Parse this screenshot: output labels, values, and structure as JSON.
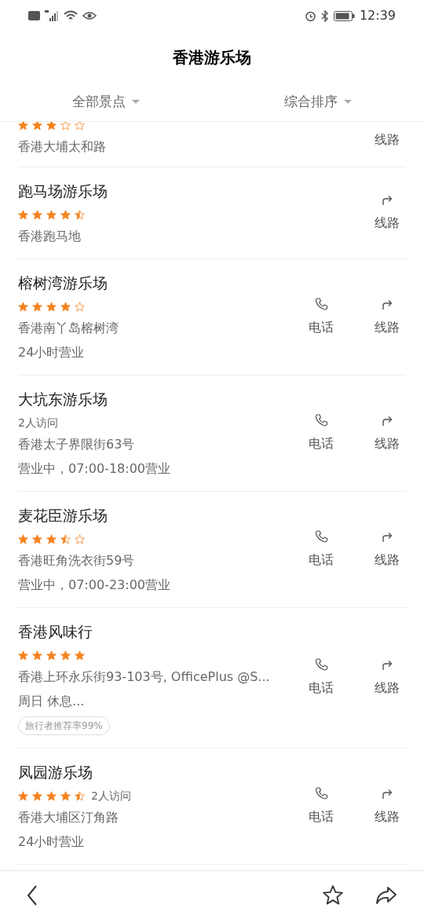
{
  "status_bar": {
    "time": "12:39"
  },
  "title": "香港游乐场",
  "filters": [
    {
      "label": "全部景点"
    },
    {
      "label": "综合排序"
    }
  ],
  "items": [
    {
      "stars": 3,
      "address": "香港大埔太和路",
      "actions": [
        {
          "kind": "route",
          "label": "线路"
        }
      ]
    },
    {
      "name": "跑马场游乐场",
      "stars": 4.5,
      "address": "香港跑马地",
      "actions": [
        {
          "kind": "route",
          "label": "线路"
        }
      ]
    },
    {
      "name": "榕树湾游乐场",
      "stars": 4,
      "address": "香港南丫岛榕树湾",
      "hours": "24小时营业",
      "actions": [
        {
          "kind": "phone",
          "label": "电话"
        },
        {
          "kind": "route",
          "label": "线路"
        }
      ]
    },
    {
      "name": "大坑东游乐场",
      "visits": "2人访问",
      "address": "香港太子界限街63号",
      "hours": "营业中，07:00-18:00营业",
      "actions": [
        {
          "kind": "phone",
          "label": "电话"
        },
        {
          "kind": "route",
          "label": "线路"
        }
      ]
    },
    {
      "name": "麦花臣游乐场",
      "stars": 3.5,
      "address": "香港旺角洗衣街59号",
      "hours": "营业中，07:00-23:00营业",
      "actions": [
        {
          "kind": "phone",
          "label": "电话"
        },
        {
          "kind": "route",
          "label": "线路"
        }
      ]
    },
    {
      "name": "香港风味行",
      "stars": 5,
      "address": "香港上环永乐街93-103号, OfficePlus @S...",
      "hours": "周日 休息...",
      "tag": "旅行者推荐率99%",
      "actions": [
        {
          "kind": "phone",
          "label": "电话"
        },
        {
          "kind": "route",
          "label": "线路"
        }
      ]
    },
    {
      "name": "凤园游乐场",
      "stars": 4.5,
      "visits": "2人访问",
      "address": "香港大埔区汀角路",
      "hours": "24小时营业",
      "actions": [
        {
          "kind": "phone",
          "label": "电话"
        },
        {
          "kind": "route",
          "label": "线路"
        }
      ]
    }
  ]
}
